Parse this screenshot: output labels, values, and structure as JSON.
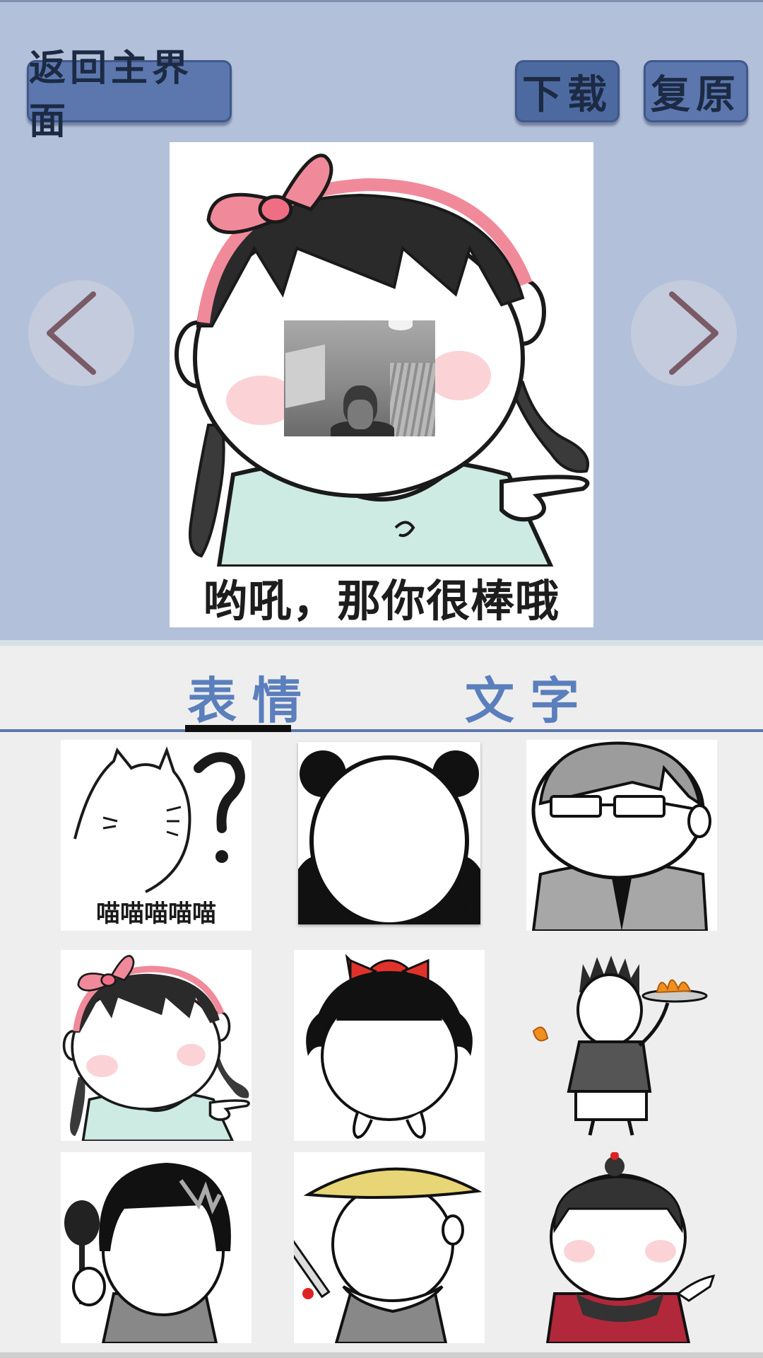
{
  "toolbar": {
    "back_label": "返回主界面",
    "download_label": "下载",
    "restore_label": "复原"
  },
  "preview": {
    "caption": "哟吼，那你很棒哦"
  },
  "tabs": [
    {
      "label": "表情",
      "selected": true
    },
    {
      "label": "文字",
      "selected": false
    }
  ],
  "grid": {
    "tiles": [
      {
        "caption": "喵喵喵喵喵"
      }
    ]
  },
  "colors": {
    "top_background": "#b3c0da",
    "button": "#5b77ad",
    "tab_text": "#5b7fbd",
    "arrow": "#7a5a66"
  }
}
